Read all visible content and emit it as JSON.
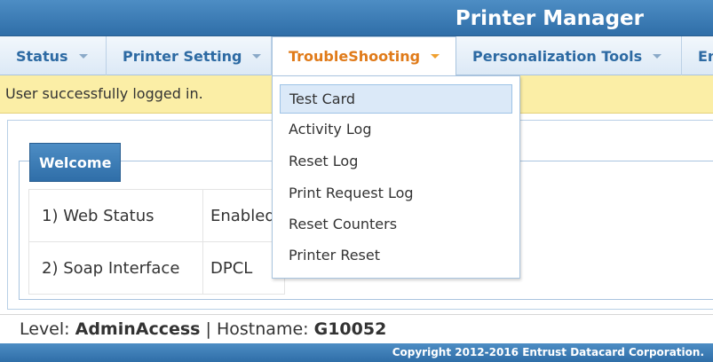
{
  "app_title": "Printer Manager",
  "menu": [
    {
      "label": "Status",
      "active": false
    },
    {
      "label": "Printer Setting",
      "active": false
    },
    {
      "label": "TroubleShooting",
      "active": true
    },
    {
      "label": "Personalization Tools",
      "active": false
    },
    {
      "label": "En",
      "active": false
    }
  ],
  "notice": "User successfully logged in.",
  "welcome": {
    "legend": "Welcome",
    "rows": [
      {
        "key": "1) Web Status",
        "value": "Enabled"
      },
      {
        "key": "2) Soap Interface",
        "value": "DPCL"
      }
    ]
  },
  "dropdown": {
    "items": [
      "Test Card",
      "Activity Log",
      "Reset Log",
      "Print Request Log",
      "Reset Counters",
      "Printer Reset"
    ],
    "highlighted": "Test Card"
  },
  "footer": {
    "level_label": "Level:",
    "level_value": "AdminAccess",
    "separator": "|",
    "hostname_label": "Hostname:",
    "hostname_value": "G10052",
    "copyright": "Copyright 2012-2016 Entrust Datacard Corporation."
  },
  "colors": {
    "brand_blue": "#3a7bb5",
    "active_menu_text": "#e07b1a",
    "notice_bg": "#fbeea6"
  }
}
